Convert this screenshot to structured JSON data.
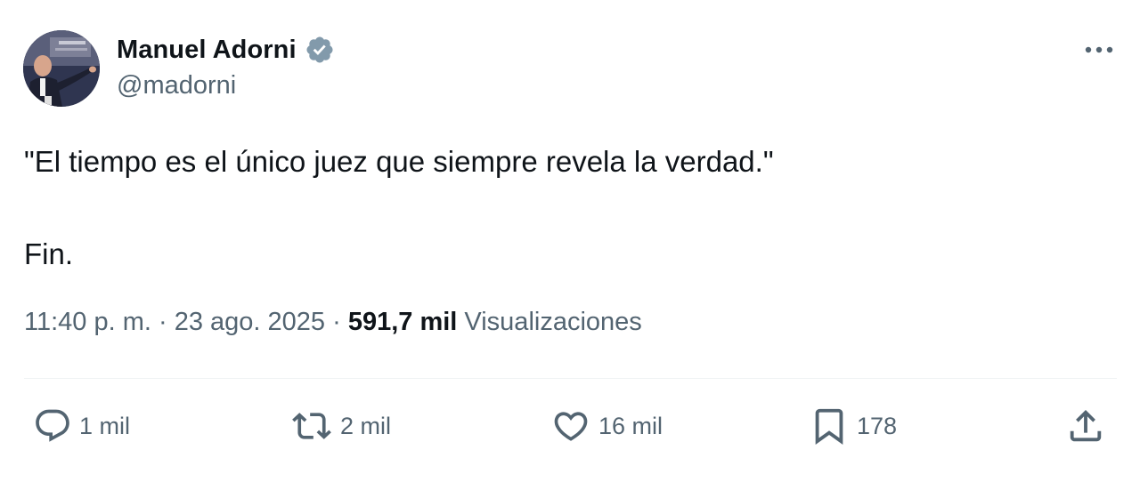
{
  "author": {
    "display_name": "Manuel Adorni",
    "handle": "@madorni",
    "verified": true
  },
  "post": {
    "line_1": "\"El tiempo es el único juez que siempre revela la verdad.\"",
    "line_2": "Fin."
  },
  "meta": {
    "time": "11:40 p. m.",
    "separator_1": " · ",
    "date": "23 ago. 2025",
    "separator_2": " · ",
    "views_count": "591,7 mil",
    "views_label": "Visualizaciones"
  },
  "actions": {
    "replies": "1 mil",
    "reposts": "2 mil",
    "likes": "16 mil",
    "bookmarks": "178"
  },
  "colors": {
    "text_primary": "#0f1419",
    "text_secondary": "#536471",
    "verified_badge": "#829aab",
    "divider": "#eff3f4"
  },
  "icons": {
    "more": "more-horizontal-icon",
    "reply": "reply-icon",
    "repost": "repost-icon",
    "like": "heart-icon",
    "bookmark": "bookmark-icon",
    "share": "share-icon",
    "verified": "verified-badge-icon"
  }
}
